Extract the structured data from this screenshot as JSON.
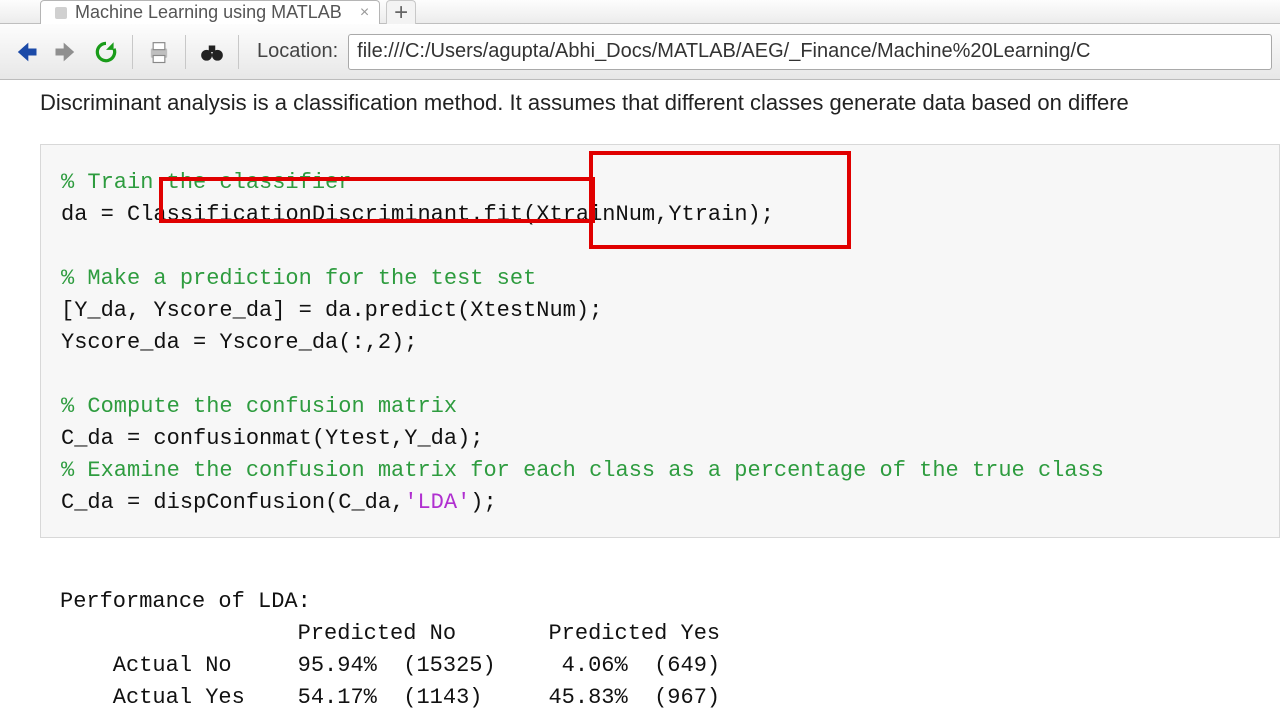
{
  "tab": {
    "title": "Machine Learning using MATLAB"
  },
  "toolbar": {
    "location_label": "Location:",
    "location_value": "file:///C:/Users/agupta/Abhi_Docs/MATLAB/AEG/_Finance/Machine%20Learning/C"
  },
  "page": {
    "description": "Discriminant analysis is a classification method. It assumes that different classes generate data based on differe"
  },
  "code": {
    "c1": "% Train the classifier",
    "l1a": "da = ",
    "l1b": "ClassificationDiscriminant.fit",
    "l1c": "(XtrainNum,Ytrain)",
    "l1d": ";",
    "c2": "% Make a prediction for the test set",
    "l2": "[Y_da, Yscore_da] = da.predict(XtestNum);",
    "l3": "Yscore_da = Yscore_da(:,2);",
    "c3": "% Compute the confusion matrix",
    "l4": "C_da = confusionmat(Ytest,Y_da);",
    "c4": "% Examine the confusion matrix for each class as a percentage of the true class",
    "l5a": "C_da = dispConfusion(C_da,",
    "l5b": "'LDA'",
    "l5c": ");"
  },
  "output": {
    "title": "Performance of LDA:",
    "header": "                  Predicted No       Predicted Yes",
    "row1": "    Actual No     95.94%  (15325)     4.06%  (649)",
    "row2": "    Actual Yes    54.17%  (1143)     45.83%  (967)"
  }
}
